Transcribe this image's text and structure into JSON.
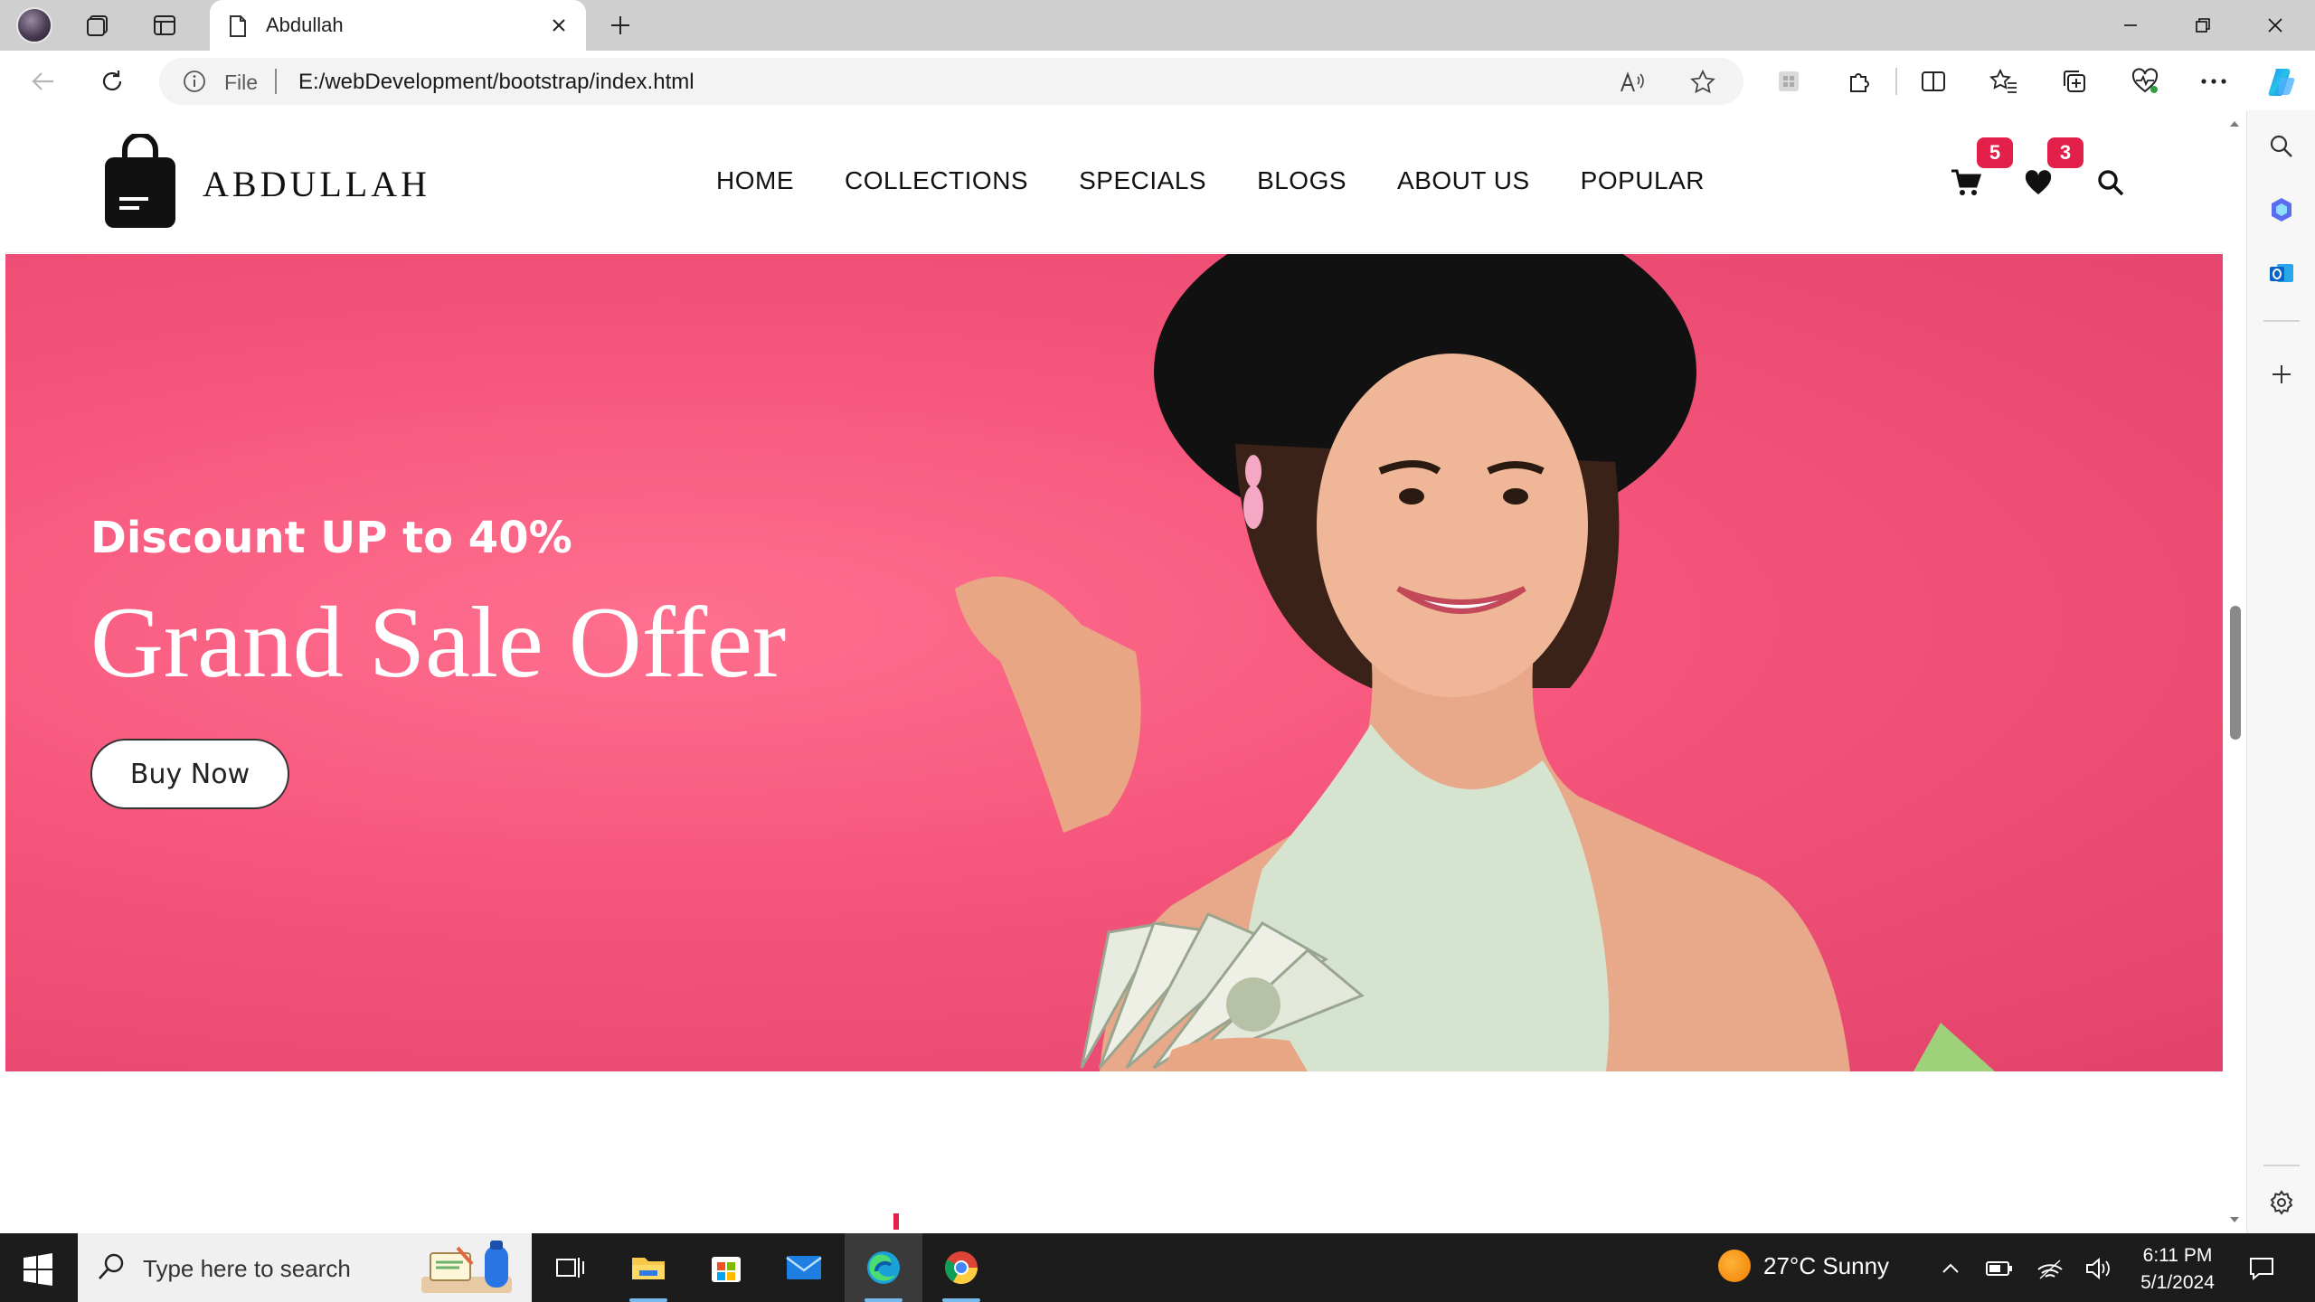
{
  "browser": {
    "tab_title": "Abdullah",
    "address_prefix": "File",
    "url": "E:/webDevelopment/bootstrap/index.html"
  },
  "site": {
    "brand": "ABDULLAH",
    "nav": [
      "HOME",
      "COLLECTIONS",
      "SPECIALS",
      "BLOGS",
      "ABOUT US",
      "POPULAR"
    ],
    "cart_count": "5",
    "wishlist_count": "3",
    "hero": {
      "subtitle": "Discount UP to 40%",
      "title": "Grand Sale Offer",
      "cta": "Buy Now",
      "background_color": "#f5547a"
    },
    "accent_color": "#e2204a"
  },
  "taskbar": {
    "search_placeholder": "Type here to search",
    "weather": "27°C  Sunny",
    "time": "6:11 PM",
    "date": "5/1/2024"
  }
}
